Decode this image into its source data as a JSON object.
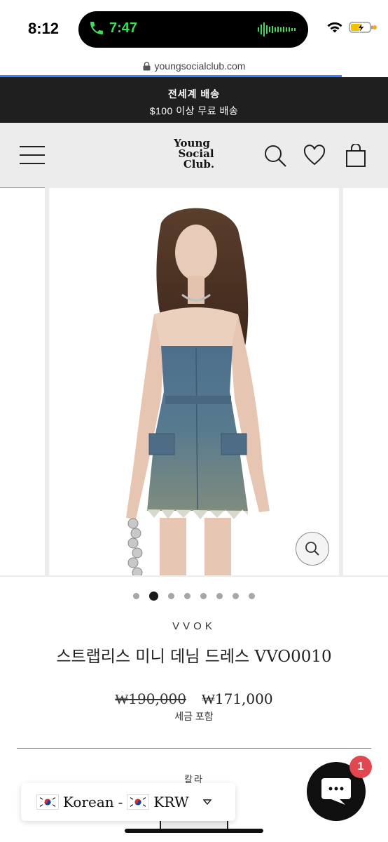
{
  "status_bar": {
    "time": "8:12",
    "call_time": "7:47",
    "accent_call": "#3ddc5a",
    "icons": [
      "phone-icon",
      "waveform-icon",
      "wifi-icon",
      "battery-charging-icon"
    ]
  },
  "browser": {
    "url": "youngsocialclub.com",
    "load_progress": 0.88
  },
  "announcement": {
    "line1": "전세계 배송",
    "line2": "$100 이상 무료 배송"
  },
  "header": {
    "logo_lines": [
      "Young",
      "Social",
      "Club."
    ],
    "icons": [
      "menu-icon",
      "search-icon",
      "heart-icon",
      "shopping-bag-icon"
    ]
  },
  "gallery": {
    "slide_count": 8,
    "active_index": 1
  },
  "product": {
    "brand": "VVOK",
    "title": "스트랩리스 미니 데님 드레스 VVO0010",
    "price_original": "₩190,000",
    "price_sale": "₩171,000",
    "tax_note": "세금 포함",
    "option_label": "칼라"
  },
  "locale_selector": {
    "language": "Korean",
    "separator": "-",
    "currency": "KRW",
    "flag_icon": "south-korea-flag-icon"
  },
  "chat": {
    "badge_count": "1",
    "badge_color": "#e0474f"
  }
}
